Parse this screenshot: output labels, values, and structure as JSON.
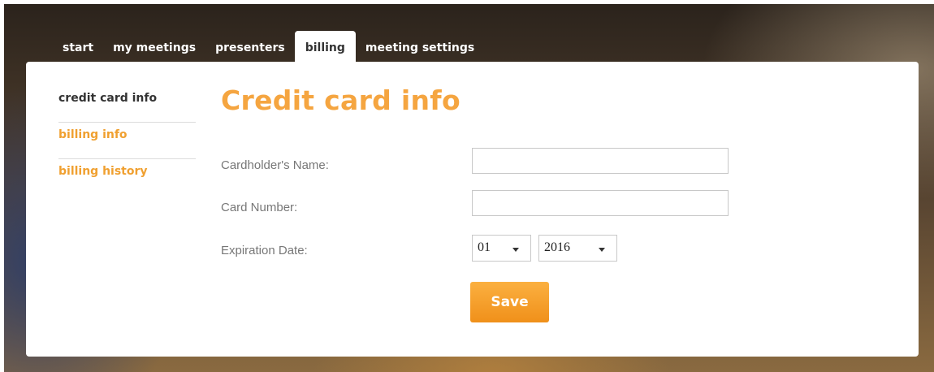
{
  "nav": {
    "tabs": [
      {
        "label": "start"
      },
      {
        "label": "my meetings"
      },
      {
        "label": "presenters"
      },
      {
        "label": "billing",
        "active": true
      },
      {
        "label": "meeting settings"
      }
    ]
  },
  "sidebar": {
    "items": [
      {
        "label": "credit card info",
        "current": true
      },
      {
        "label": "billing info"
      },
      {
        "label": "billing history"
      }
    ]
  },
  "form": {
    "title": "Credit card info",
    "cardholder_label": "Cardholder's Name:",
    "cardholder_value": "",
    "card_number_label": "Card Number:",
    "card_number_value": "",
    "expiration_label": "Expiration Date:",
    "expiration_month": "01",
    "expiration_year": "2016",
    "save_label": "Save"
  },
  "colors": {
    "accent": "#f5a540",
    "button": "#f39a22",
    "text_dark": "#333333",
    "label_gray": "#777777"
  }
}
